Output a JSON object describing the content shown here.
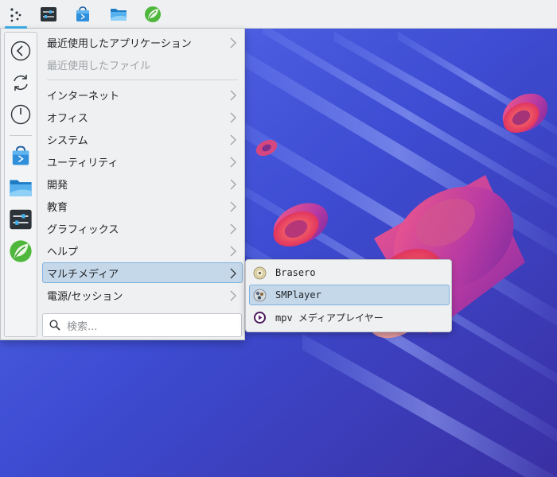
{
  "colors": {
    "accent": "#3daee9",
    "highlight_bg": "#c5d8ea",
    "highlight_border": "#7fb2de",
    "panel_bg": "#eef0f2",
    "menu_bg": "#eff0f1",
    "wallpaper_base": "#3a44b8"
  },
  "panel": {
    "buttons": [
      {
        "name": "application-launcher-icon",
        "active": true
      },
      {
        "name": "system-settings-icon"
      },
      {
        "name": "software-store-icon"
      },
      {
        "name": "file-manager-icon"
      },
      {
        "name": "leaf-app-icon"
      }
    ]
  },
  "favorites": [
    {
      "name": "back-arrow-icon"
    },
    {
      "name": "refresh-icon"
    },
    {
      "name": "power-icon"
    },
    {
      "name": "software-store-icon"
    },
    {
      "name": "file-manager-icon"
    },
    {
      "name": "system-settings-icon"
    },
    {
      "name": "leaf-app-icon"
    }
  ],
  "menu": {
    "recent_apps": "最近使用したアプリケーション",
    "recent_files": "最近使用したファイル",
    "categories": [
      "インターネット",
      "オフィス",
      "システム",
      "ユーティリティ",
      "開発",
      "教育",
      "グラフィックス",
      "ヘルプ",
      "マルチメディア",
      "電源/セッション"
    ],
    "highlighted_category": "マルチメディア"
  },
  "search": {
    "placeholder": "検索..."
  },
  "submenu": {
    "items": [
      {
        "label": "Brasero",
        "icon": "disc-icon"
      },
      {
        "label": "SMPlayer",
        "icon": "smplayer-icon",
        "highlighted": true
      },
      {
        "label": "mpv メディアプレイヤー",
        "icon": "mpv-icon"
      }
    ]
  }
}
